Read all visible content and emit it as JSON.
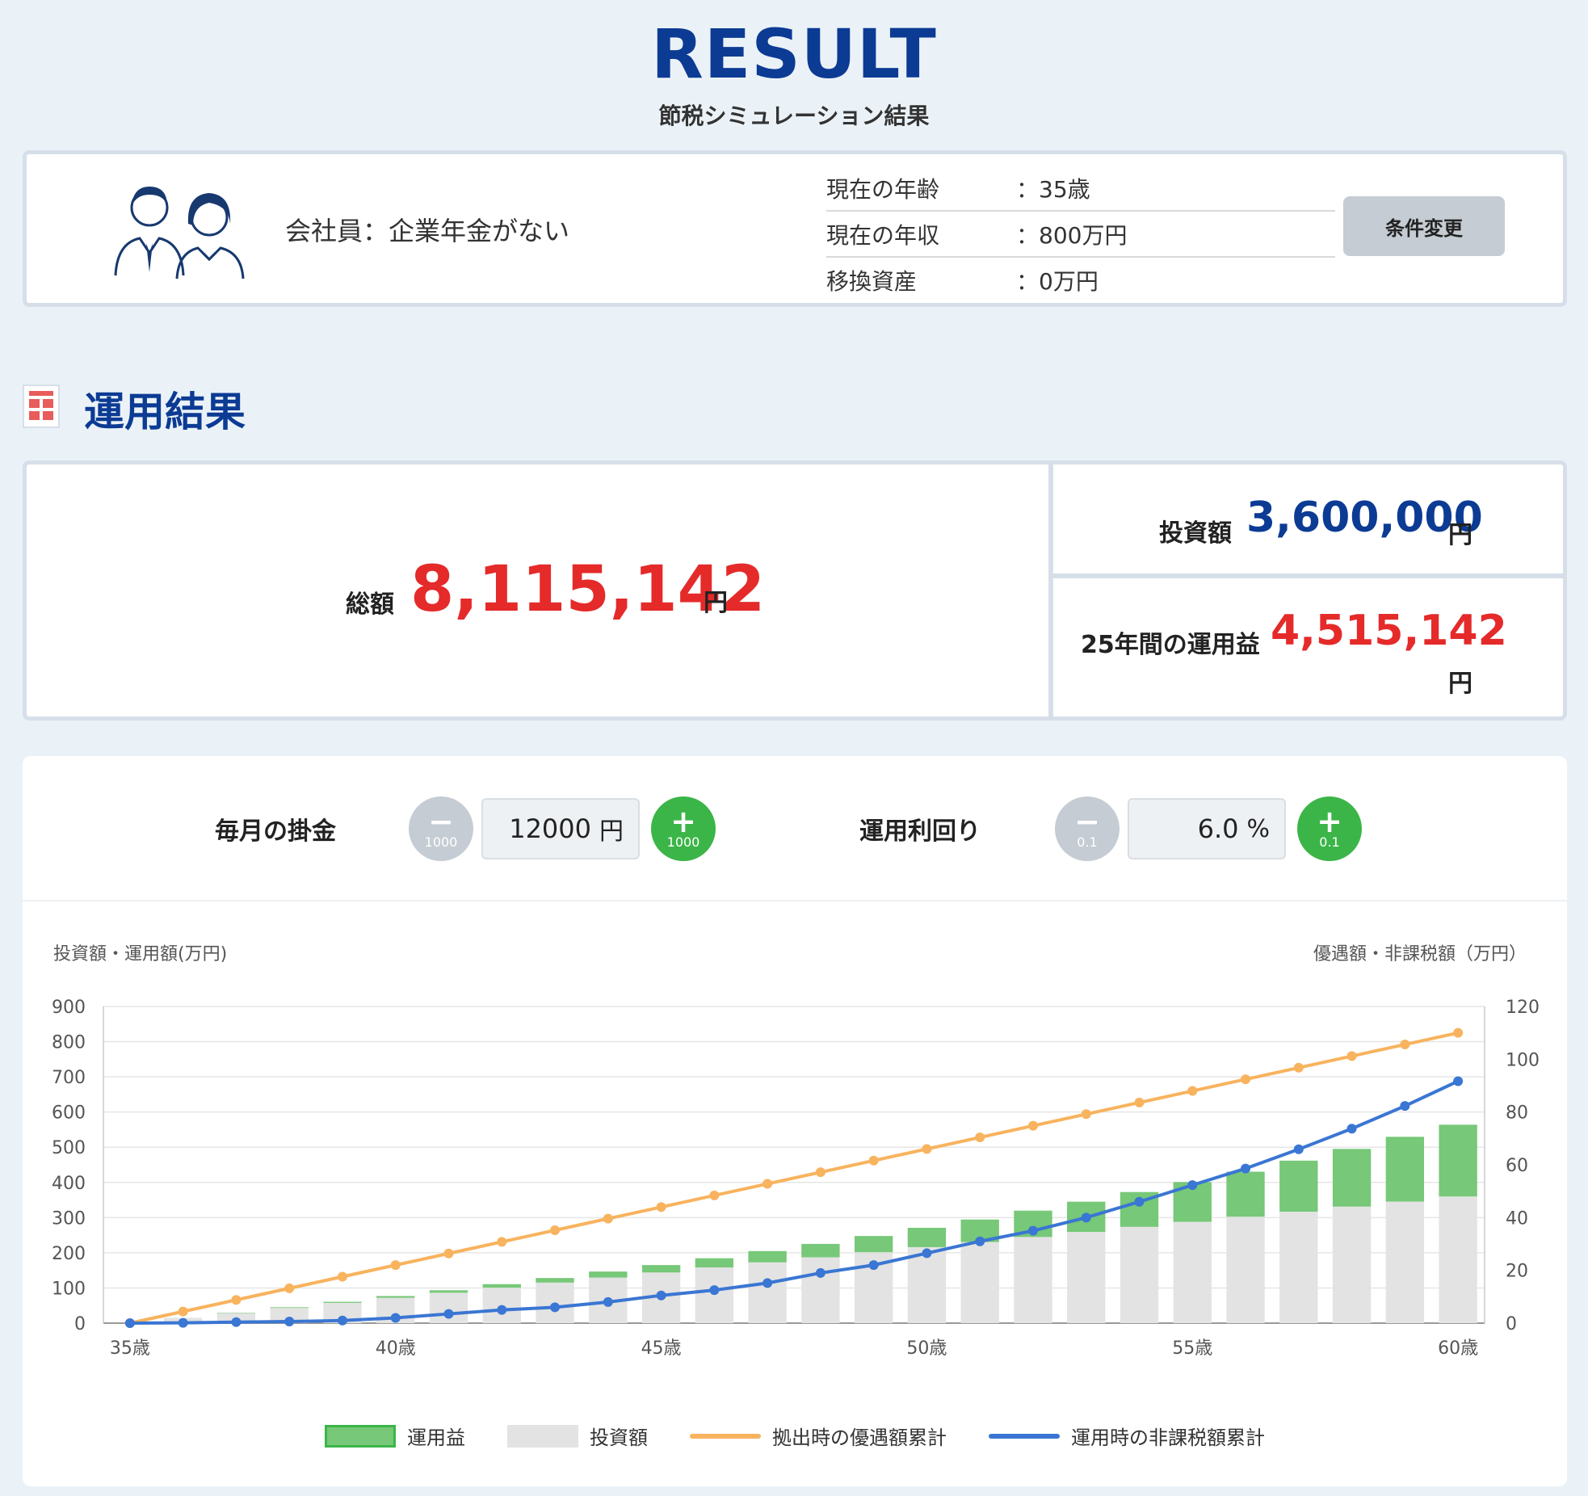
{
  "header": {
    "title": "RESULT",
    "subtitle": "節税シミュレーション結果"
  },
  "profile": {
    "employment": "会社員：企業年金がない",
    "rows": [
      {
        "label": "現在の年齢",
        "value": "：35歳"
      },
      {
        "label": "現在の年収",
        "value": "：800万円"
      },
      {
        "label": "移換資産",
        "value": "：0万円"
      }
    ],
    "change_button": "条件変更",
    "icon": "people-icon"
  },
  "section": {
    "title": "運用結果",
    "icon": "calculator-icon"
  },
  "result": {
    "total_label": "総額",
    "total_value": "8,115,142",
    "total_unit": "円",
    "invest_label": "投資額",
    "invest_value": "3,600,000",
    "invest_unit": "円",
    "gain_label": "25年間の運用益",
    "gain_value": "4,515,142",
    "gain_unit": "円"
  },
  "controls": {
    "monthly": {
      "label": "毎月の掛金",
      "value": "12000",
      "unit": "円",
      "minus_sym": "−",
      "minus_step": "1000",
      "plus_sym": "+",
      "plus_step": "1000"
    },
    "rate": {
      "label": "運用利回り",
      "value": "6.0",
      "unit": "%",
      "minus_sym": "−",
      "minus_step": "0.1",
      "plus_sym": "+",
      "plus_step": "0.1"
    }
  },
  "colors": {
    "primary": "#0c3b94",
    "red": "#e52a2a",
    "green": "#3bb548",
    "bar_gain": "#77c878",
    "bar_invest": "#e3e3e3",
    "line_orange": "#f8b35e",
    "line_blue": "#3a76d3"
  },
  "chart_data": {
    "type": "bar",
    "left_axis_title": "投資額・運用額(万円)",
    "right_axis_title": "優遇額・非課税額（万円）",
    "left_ylim": [
      0,
      900
    ],
    "right_ylim": [
      0,
      120
    ],
    "left_ticks": [
      "900",
      "800",
      "700",
      "600",
      "500",
      "400",
      "300",
      "200",
      "100",
      "0"
    ],
    "right_ticks": [
      "120",
      "100",
      "80",
      "60",
      "40",
      "20",
      "0"
    ],
    "x_ticks": [
      "35歳",
      "40歳",
      "45歳",
      "50歳",
      "55歳",
      "60歳"
    ],
    "x": [
      35,
      36,
      37,
      38,
      39,
      40,
      41,
      42,
      43,
      44,
      45,
      46,
      47,
      48,
      49,
      50,
      51,
      52,
      53,
      54,
      55,
      56,
      57,
      58,
      59,
      60
    ],
    "series": [
      {
        "name": "運用益",
        "axis": "left",
        "kind": "bar-stack-top",
        "values": [
          0,
          0.3,
          1,
          2,
          3,
          5,
          7,
          10,
          13,
          17,
          21,
          26,
          32,
          38,
          46,
          55,
          64,
          75,
          86,
          99,
          113,
          128,
          145,
          164,
          184,
          204
        ]
      },
      {
        "name": "投資額",
        "axis": "left",
        "kind": "bar-stack-base",
        "values": [
          0,
          14.4,
          28.8,
          43.2,
          57.6,
          72,
          86.4,
          100.8,
          115.2,
          129.6,
          144,
          158.4,
          172.8,
          187.2,
          201.6,
          216,
          230.4,
          244.8,
          259.2,
          273.6,
          288,
          302.4,
          316.8,
          331.2,
          345.6,
          360
        ]
      },
      {
        "name": "拠出時の優遇額累計",
        "axis": "right",
        "kind": "line",
        "values": [
          0,
          4.4,
          8.8,
          13.2,
          17.6,
          22,
          26.4,
          30.8,
          35.2,
          39.6,
          44,
          48.4,
          52.8,
          57.2,
          61.6,
          66,
          70.4,
          74.8,
          79.2,
          83.6,
          88,
          92.4,
          96.8,
          101.2,
          105.6,
          110
        ]
      },
      {
        "name": "運用時の非課税額累計",
        "axis": "right",
        "kind": "line",
        "values": [
          0,
          0.1,
          0.4,
          0.6,
          1,
          2,
          3.5,
          5,
          6,
          8,
          10.5,
          12.5,
          15.2,
          19,
          22,
          26.5,
          31,
          35,
          40,
          46,
          52.3,
          58.6,
          65.9,
          73.7,
          82.3,
          91.7
        ]
      }
    ],
    "legend": [
      {
        "label": "運用益",
        "type": "box"
      },
      {
        "label": "投資額",
        "type": "box"
      },
      {
        "label": "拠出時の優遇額累計",
        "type": "line"
      },
      {
        "label": "運用時の非課税額累計",
        "type": "line"
      }
    ]
  }
}
